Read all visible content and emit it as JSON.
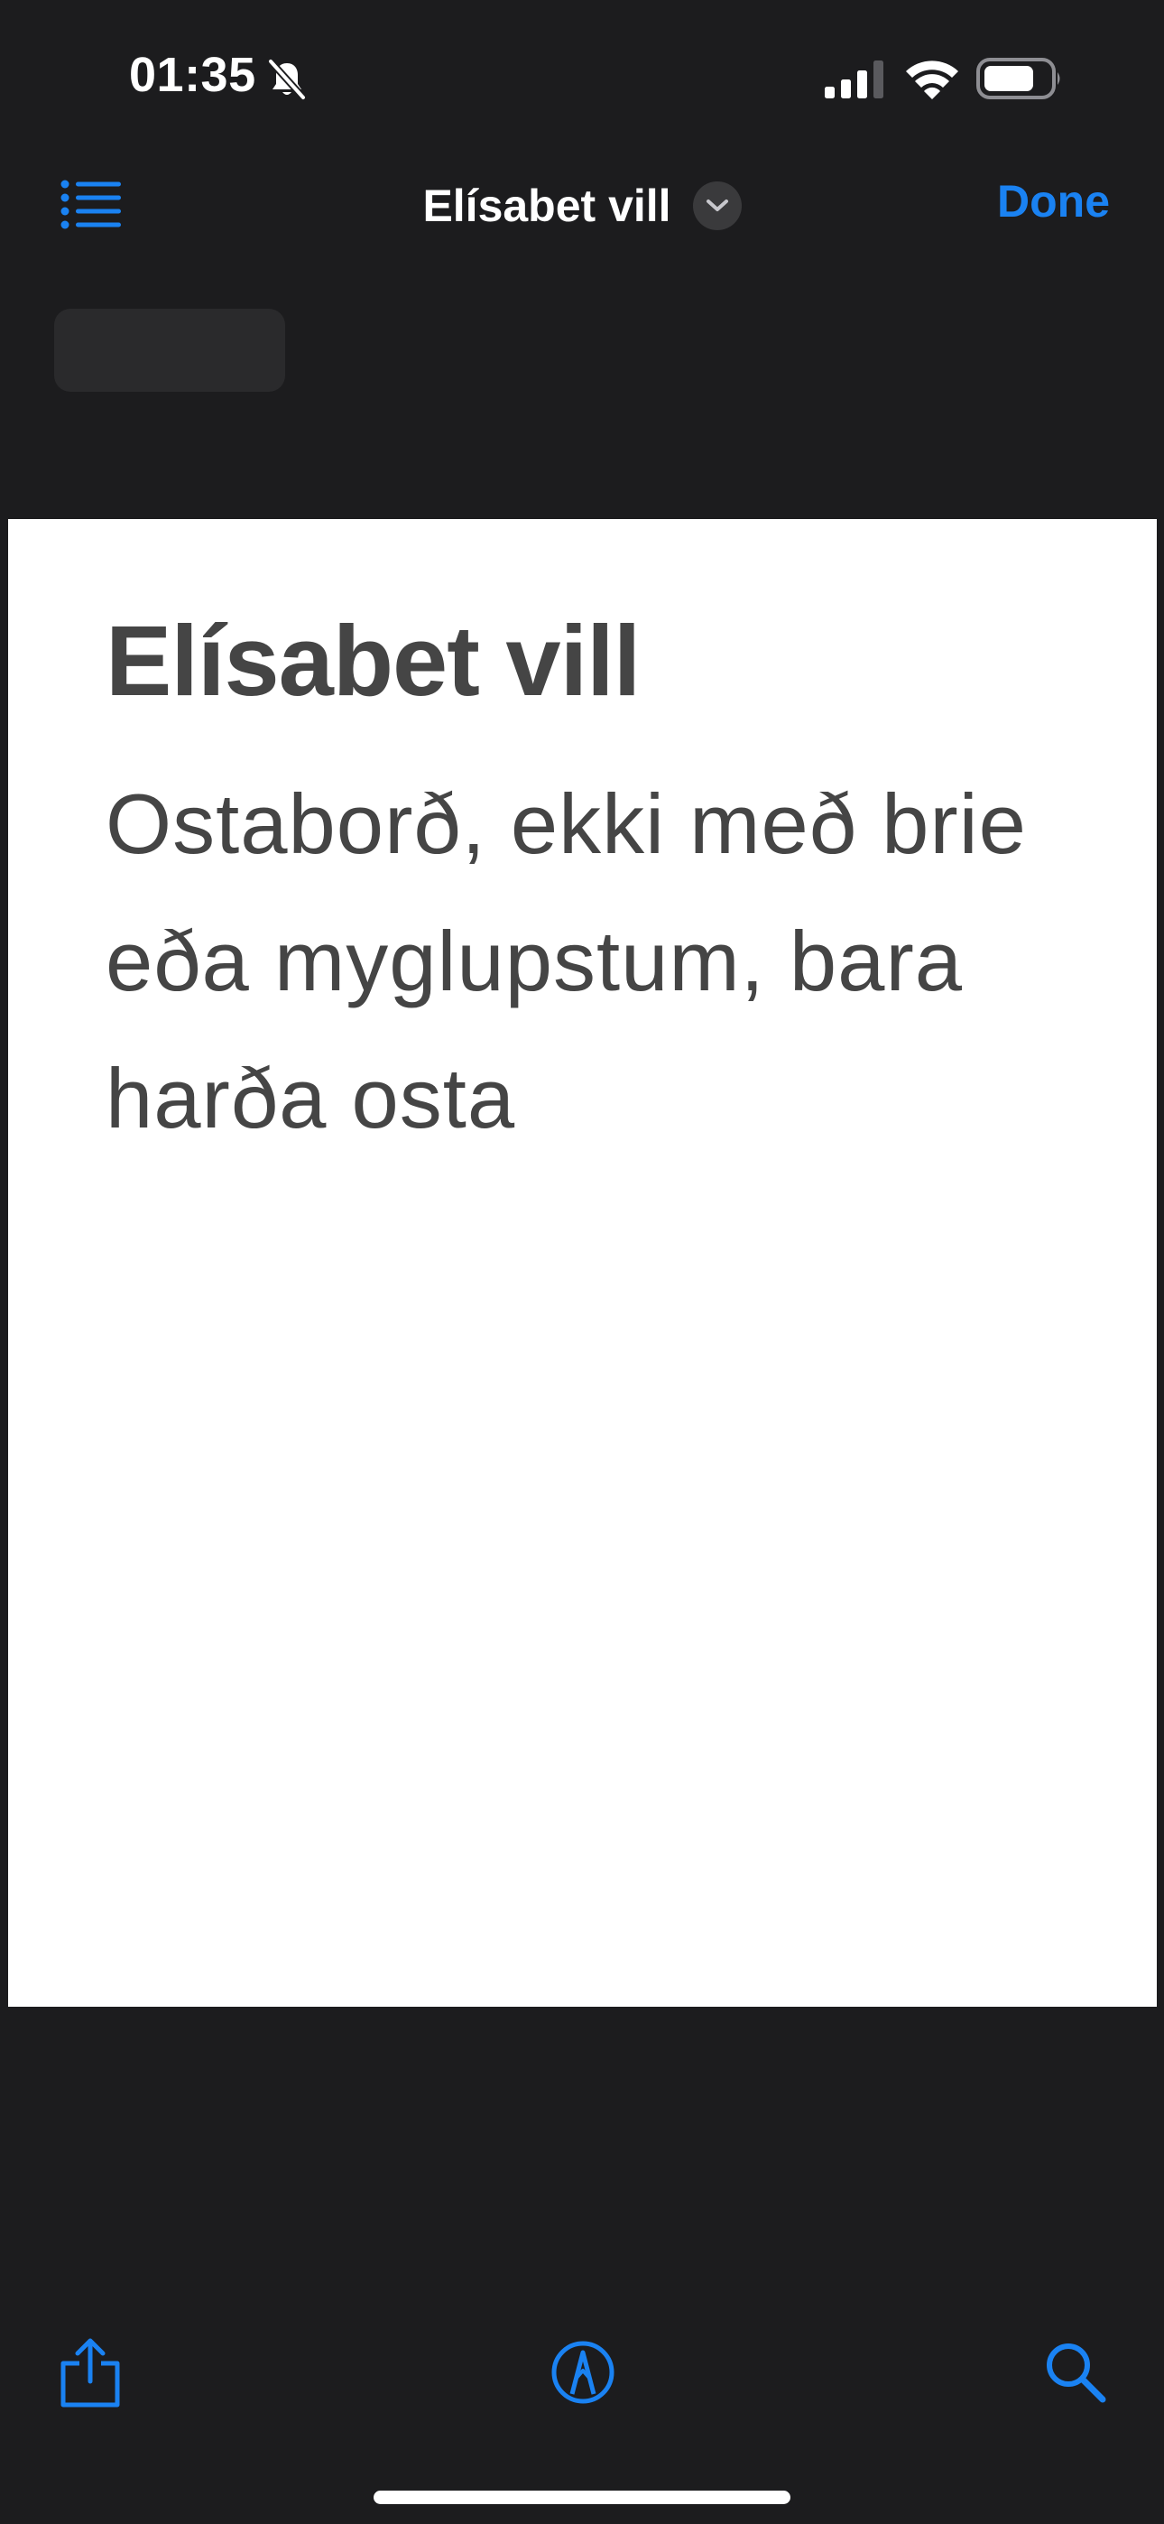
{
  "status_bar": {
    "time": "01:35",
    "icons": [
      "bell-slash-icon",
      "cellular-signal-icon",
      "wifi-icon",
      "battery-icon"
    ]
  },
  "nav": {
    "list_icon": "list-bullet-icon",
    "title": "Elísabet vill",
    "title_icon": "chevron-down-icon",
    "done_label": "Done"
  },
  "document": {
    "title": "Elísabet vill",
    "body": "Ostaborð, ekki með brie eða myglupstum, bara harða osta"
  },
  "toolbar": {
    "icons": [
      "share-icon",
      "markup-pen-icon",
      "search-icon"
    ]
  },
  "colors": {
    "accent": "#1a82f2",
    "background": "#1c1c1e",
    "page": "#ffffff",
    "text": "#454545"
  }
}
